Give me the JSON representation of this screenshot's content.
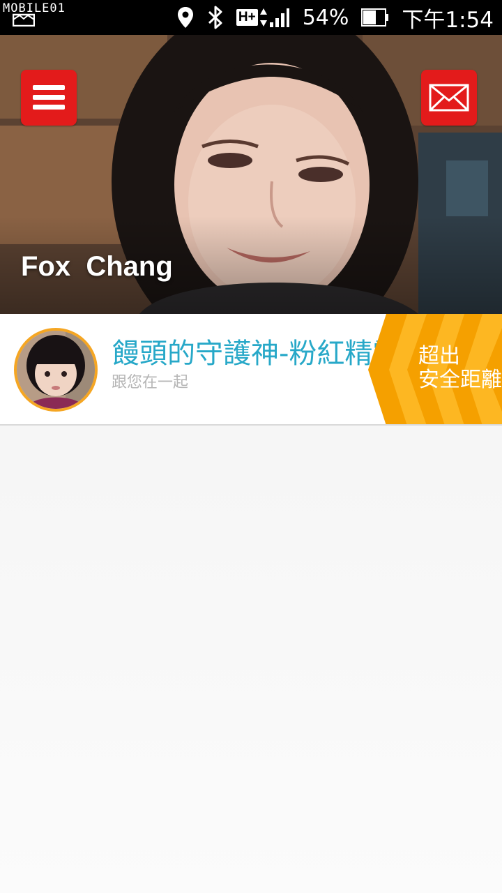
{
  "status_bar": {
    "watermark": "MOBILE01",
    "notification_icon": "image-notification-icon",
    "icons": [
      "location-icon",
      "bluetooth-icon",
      "hplus-network-icon",
      "signal-icon"
    ],
    "network_label": "H+",
    "battery_percent": "54%",
    "battery_icon": "battery-icon",
    "time": "下午1:54"
  },
  "header": {
    "menu_icon": "hamburger-menu-icon",
    "mail_icon": "envelope-icon",
    "accent_color": "#e31b1b",
    "user_name": "Fox  Chang"
  },
  "child_card": {
    "name": "饅頭的守護神-粉紅精靈",
    "status": "跟您在一起",
    "name_color": "#27a8c8",
    "alert": {
      "line1": "超出",
      "line2": "安全距離",
      "color": "#f5a000"
    }
  }
}
